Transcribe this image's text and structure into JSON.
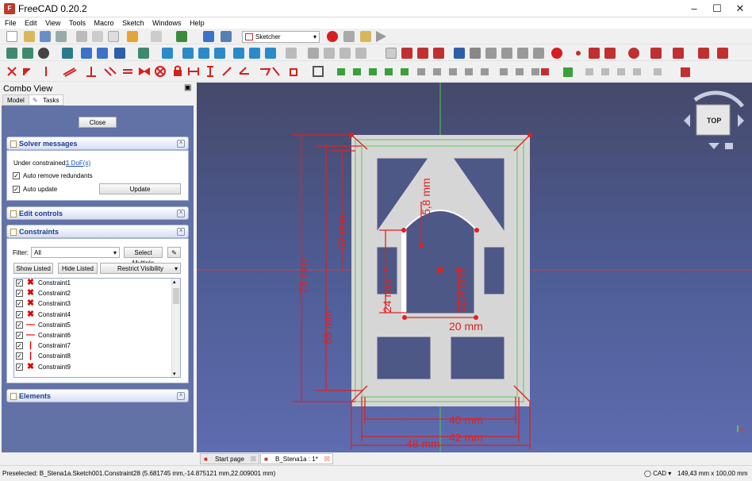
{
  "app": {
    "title": "FreeCAD 0.20.2"
  },
  "menu": [
    "File",
    "Edit",
    "View",
    "Tools",
    "Macro",
    "Sketch",
    "Windows",
    "Help"
  ],
  "toolbar": {
    "workbench": "Sketcher"
  },
  "combo": {
    "title": "Combo View",
    "tabs": {
      "model": "Model",
      "tasks": "Tasks"
    },
    "close_label": "Close",
    "solver": {
      "title": "Solver messages",
      "status_label": "Under constrained:",
      "dof_link": "1 DoF(s)",
      "auto_remove": "Auto remove redundants",
      "auto_update": "Auto update",
      "update_label": "Update"
    },
    "edit_controls": {
      "title": "Edit controls"
    },
    "constraints": {
      "title": "Constraints",
      "filter_label": "Filter:",
      "filter_value": "All",
      "select_multiple": "Select Multiple",
      "show_listed": "Show Listed",
      "hide_listed": "Hide Listed",
      "restrict_visibility": "Restrict Visibility",
      "items": [
        {
          "name": "Constraint1",
          "icon": "coincident"
        },
        {
          "name": "Constraint2",
          "icon": "coincident"
        },
        {
          "name": "Constraint3",
          "icon": "coincident"
        },
        {
          "name": "Constraint4",
          "icon": "coincident"
        },
        {
          "name": "Constraint5",
          "icon": "horizontal"
        },
        {
          "name": "Constraint6",
          "icon": "horizontal"
        },
        {
          "name": "Constraint7",
          "icon": "vertical"
        },
        {
          "name": "Constraint8",
          "icon": "vertical"
        },
        {
          "name": "Constraint9",
          "icon": "coincident"
        }
      ]
    },
    "elements": {
      "title": "Elements"
    }
  },
  "sketch": {
    "dimensions": {
      "d73": "73 mm",
      "d65": "65 mm",
      "d67": "67 mm",
      "d5_8": "5,8 mm",
      "d24": "24 mm",
      "d12_4": "12,4 mm",
      "d20": "20 mm",
      "d40": "40 mm",
      "d42": "42 mm",
      "d48": "48 mm"
    }
  },
  "navcube": {
    "face": "TOP"
  },
  "doctabs": {
    "start": "Start page",
    "doc": "B_Stena1a : 1*"
  },
  "status": {
    "preselected": "Preselected: B_Stena1a.Sketch001.Constraint28 (5.681745 mm,-14.875121 mm,22.009001 mm)",
    "nav_style": "CAD",
    "dimensions": "149,43 mm x 100,00 mm"
  },
  "colors": {
    "constraint_red": "#e02020",
    "sketch_green": "#5dc85d",
    "accent": "#1d3d8f"
  }
}
